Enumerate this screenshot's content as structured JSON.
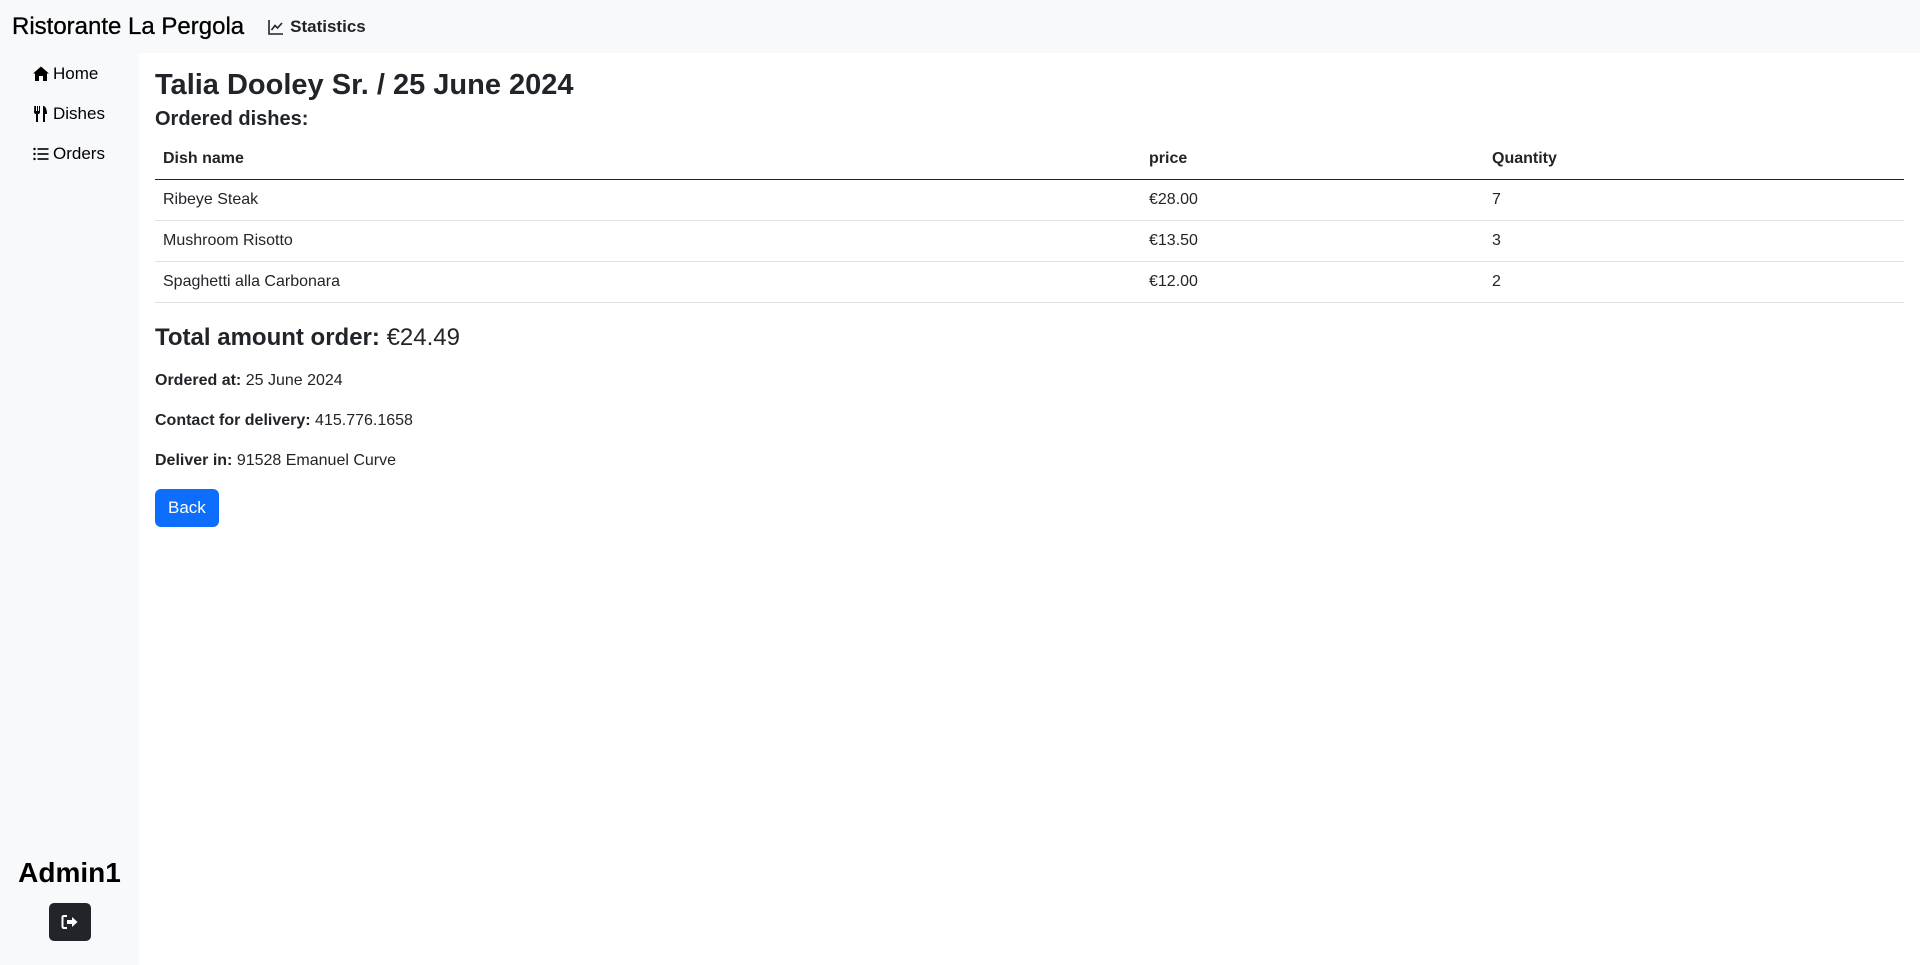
{
  "header": {
    "brand": "Ristorante La Pergola",
    "statistics_label": "Statistics"
  },
  "sidebar": {
    "items": [
      {
        "label": "Home",
        "icon": "home-icon"
      },
      {
        "label": "Dishes",
        "icon": "utensils-icon"
      },
      {
        "label": "Orders",
        "icon": "list-icon"
      }
    ],
    "user": "Admin1",
    "logout_icon": "logout-icon"
  },
  "order": {
    "title": "Talia Dooley Sr. / 25 June 2024",
    "dishes_heading": "Ordered dishes:",
    "columns": [
      "Dish name",
      "price",
      "Quantity"
    ],
    "rows": [
      [
        "Ribeye Steak",
        "€28.00",
        "7"
      ],
      [
        "Mushroom Risotto",
        "€13.50",
        "3"
      ],
      [
        "Spaghetti alla Carbonara",
        "€12.00",
        "2"
      ]
    ],
    "total_label": "Total amount order:",
    "total_value": "€24.49",
    "ordered_at_label": "Ordered at:",
    "ordered_at_value": "25 June 2024",
    "contact_label": "Contact for delivery:",
    "contact_value": "415.776.1658",
    "deliver_label": "Deliver in:",
    "deliver_value": "91528 Emanuel Curve",
    "back_label": "Back"
  },
  "colors": {
    "primary": "#0d6efd",
    "dark": "#212529",
    "sidebar_bg": "#f8f9fa"
  }
}
